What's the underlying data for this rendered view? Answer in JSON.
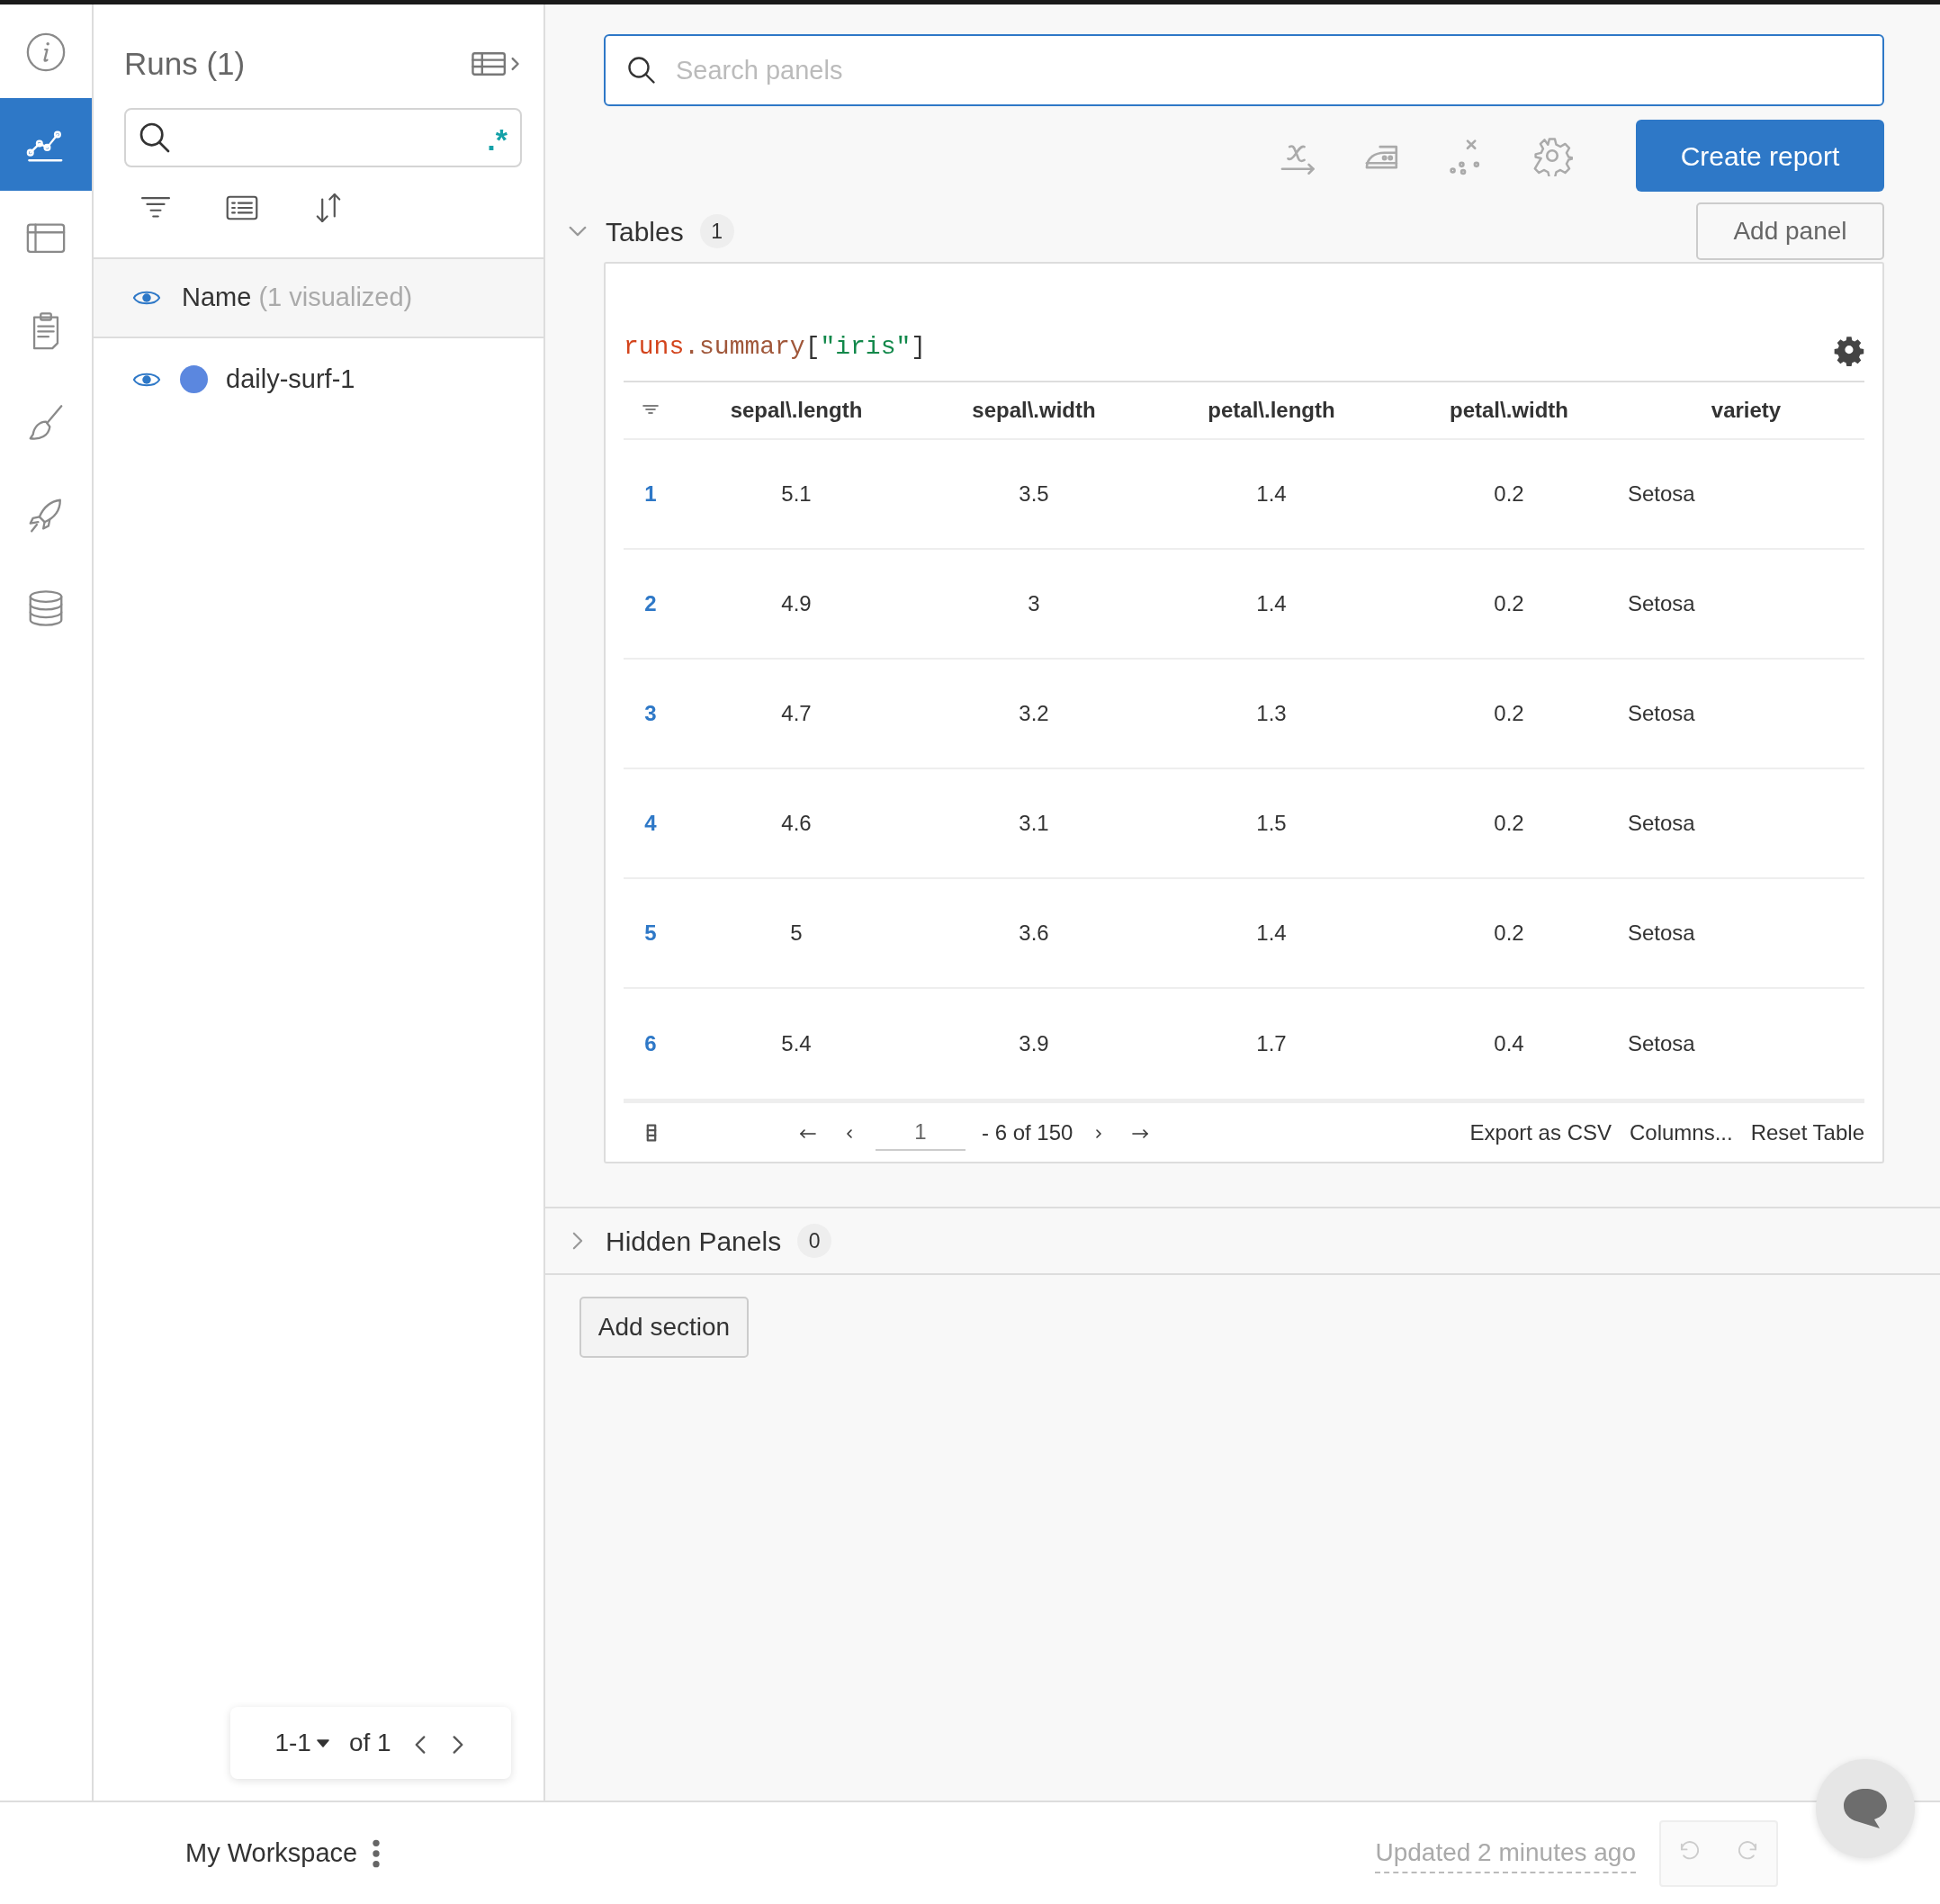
{
  "sidebar": {
    "items": [
      {
        "kind": "info",
        "selected": false
      },
      {
        "kind": "chart",
        "selected": true
      },
      {
        "kind": "table",
        "selected": false
      },
      {
        "kind": "report",
        "selected": false
      },
      {
        "kind": "brush",
        "selected": false
      },
      {
        "kind": "rocket",
        "selected": false
      },
      {
        "kind": "database",
        "selected": false
      }
    ]
  },
  "runs_panel": {
    "title": "Runs (1)",
    "regex_toggle": ".*",
    "header": {
      "label": "Name",
      "note": "(1 visualized)",
      "visible": true
    },
    "runs": [
      {
        "name": "daily-surf-1",
        "visible": true,
        "color": "#5b87df"
      }
    ],
    "pagination": {
      "range": "1-1",
      "total": "of 1"
    }
  },
  "search": {
    "placeholder": "Search panels"
  },
  "create_report": "Create report",
  "sections": [
    {
      "title": "Tables",
      "count": "1",
      "expanded": true,
      "action": "Add panel",
      "panel": {
        "query": [
          {
            "text": "runs",
            "kind": "ident"
          },
          {
            "text": ".summary",
            "kind": "prop"
          },
          {
            "text": "[",
            "kind": "punct"
          },
          {
            "text": "\"iris\"",
            "kind": "string"
          },
          {
            "text": "]",
            "kind": "punct"
          }
        ],
        "columns": [
          "sepal\\.length",
          "sepal\\.width",
          "petal\\.length",
          "petal\\.width",
          "variety"
        ],
        "rows": [
          {
            "index": "1",
            "cells": [
              "5.1",
              "3.5",
              "1.4",
              "0.2",
              "Setosa"
            ]
          },
          {
            "index": "2",
            "cells": [
              "4.9",
              "3",
              "1.4",
              "0.2",
              "Setosa"
            ]
          },
          {
            "index": "3",
            "cells": [
              "4.7",
              "3.2",
              "1.3",
              "0.2",
              "Setosa"
            ]
          },
          {
            "index": "4",
            "cells": [
              "4.6",
              "3.1",
              "1.5",
              "0.2",
              "Setosa"
            ]
          },
          {
            "index": "5",
            "cells": [
              "5",
              "3.6",
              "1.4",
              "0.2",
              "Setosa"
            ]
          },
          {
            "index": "6",
            "cells": [
              "5.4",
              "3.9",
              "1.7",
              "0.4",
              "Setosa"
            ]
          }
        ],
        "footer": {
          "page": "1",
          "range": "- 6 of 150",
          "actions": [
            "Export as CSV",
            "Columns...",
            "Reset Table"
          ]
        }
      }
    },
    {
      "title": "Hidden Panels",
      "count": "0",
      "expanded": false
    }
  ],
  "add_section": "Add section",
  "status_bar": {
    "workspace": "My Workspace",
    "updated": "Updated 2 minutes ago"
  }
}
